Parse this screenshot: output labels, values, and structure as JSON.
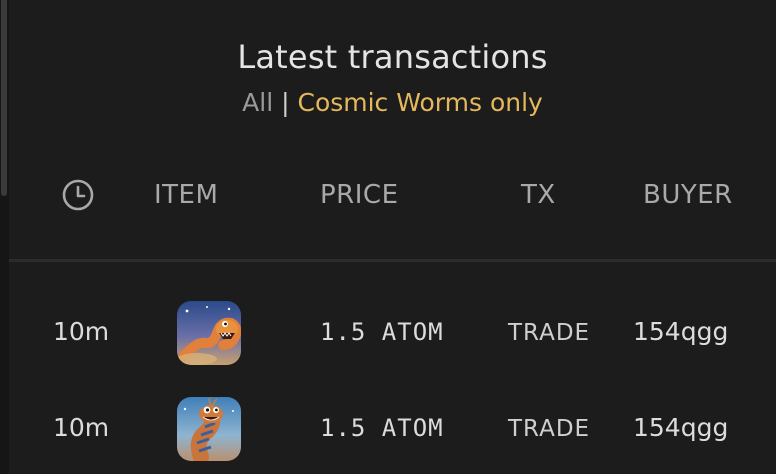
{
  "header": {
    "title": "Latest transactions",
    "filter_all": "All",
    "filter_separator": "|",
    "filter_worms": "Cosmic Worms only"
  },
  "columns": {
    "time_icon": "clock-icon",
    "item": "ITEM",
    "price": "PRICE",
    "tx": "TX",
    "buyer": "BUYER"
  },
  "rows": [
    {
      "time": "10m",
      "image": "cosmic-worm-orange",
      "price": "1.5 ATOM",
      "tx": "TRADE",
      "buyer": "154qgg"
    },
    {
      "time": "10m",
      "image": "cosmic-worm-striped",
      "price": "1.5 ATOM",
      "tx": "TRADE",
      "buyer": "154qgg"
    }
  ],
  "colors": {
    "background": "#1c1c1c",
    "accent": "#e6b85c",
    "muted": "#9a9a9a"
  }
}
